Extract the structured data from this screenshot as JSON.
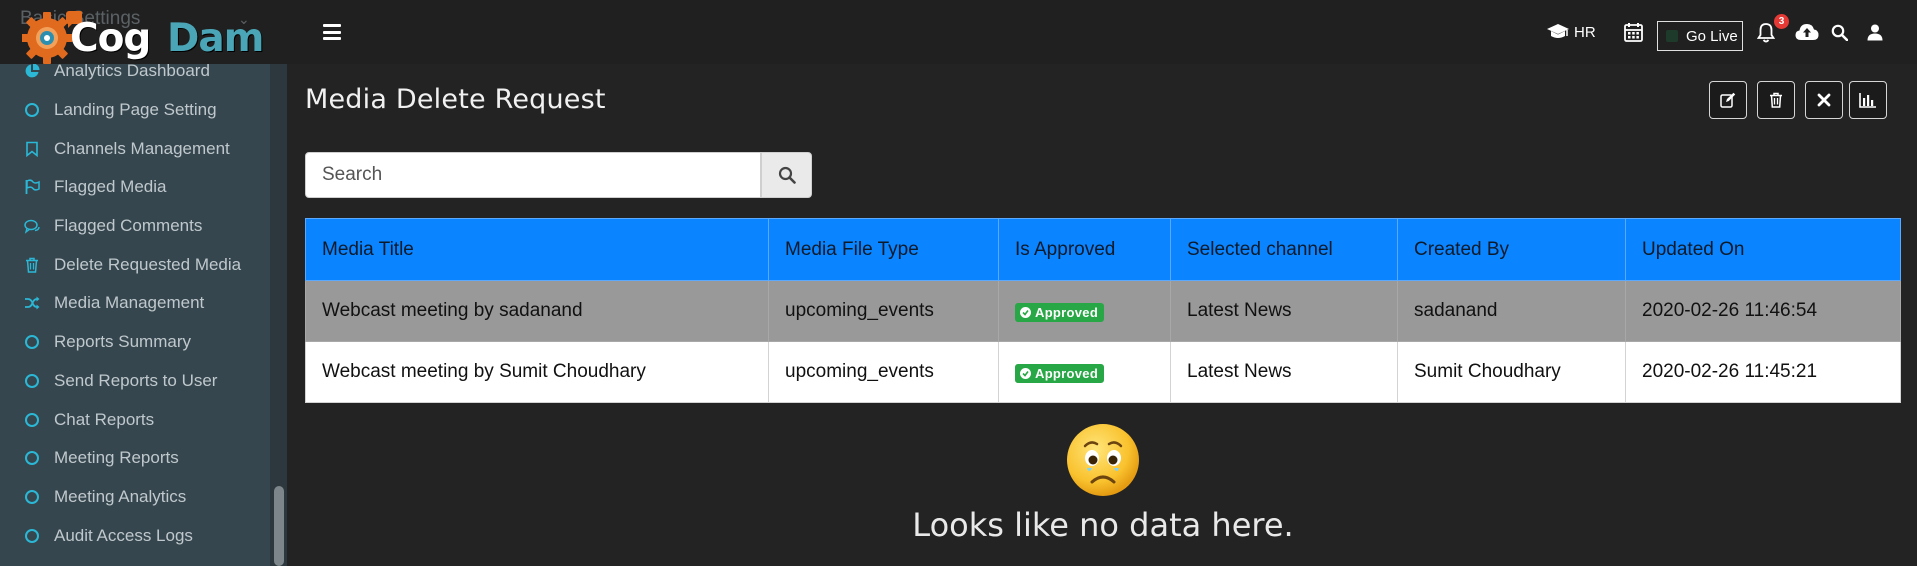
{
  "brand": {
    "logo_part1": "Cog",
    "logo_part2": "Dam",
    "hidden_menu_label": "Basic Settings"
  },
  "sidebar": {
    "items": [
      {
        "label": "Analytics Dashboard",
        "icon": "pie-chart-icon"
      },
      {
        "label": "Landing Page Setting",
        "icon": "circle-icon"
      },
      {
        "label": "Channels Management",
        "icon": "bookmark-icon"
      },
      {
        "label": "Flagged Media",
        "icon": "flag-icon"
      },
      {
        "label": "Flagged Comments",
        "icon": "comments-icon"
      },
      {
        "label": "Delete Requested Media",
        "icon": "trash-icon"
      },
      {
        "label": "Media Management",
        "icon": "shuffle-icon"
      },
      {
        "label": "Reports Summary",
        "icon": "circle-icon"
      },
      {
        "label": "Send Reports to User",
        "icon": "circle-icon"
      },
      {
        "label": "Chat Reports",
        "icon": "circle-icon"
      },
      {
        "label": "Meeting Reports",
        "icon": "circle-icon"
      },
      {
        "label": "Meeting Analytics",
        "icon": "circle-icon"
      },
      {
        "label": "Audit Access Logs",
        "icon": "circle-icon"
      }
    ]
  },
  "topbar": {
    "hr_label": "HR",
    "go_live_label": "Go Live",
    "notification_count": "3"
  },
  "page": {
    "title": "Media Delete Request",
    "search_placeholder": "Search",
    "empty_message": "Looks like no data here."
  },
  "table": {
    "columns": [
      "Media Title",
      "Media File Type",
      "Is Approved",
      "Selected channel",
      "Created By",
      "Updated On"
    ],
    "rows": [
      {
        "media_title": "Webcast meeting by sadanand",
        "media_file_type": "upcoming_events",
        "is_approved": "Approved",
        "selected_channel": "Latest News",
        "created_by": "sadanand",
        "updated_on": "2020-02-26 11:46:54"
      },
      {
        "media_title": "Webcast meeting by Sumit Choudhary",
        "media_file_type": "upcoming_events",
        "is_approved": "Approved",
        "selected_channel": "Latest News",
        "created_by": "Sumit Choudhary",
        "updated_on": "2020-02-26 11:45:21"
      }
    ]
  },
  "colors": {
    "header_blue": "#0a84ff",
    "approved_green": "#27a745",
    "sidebar_bg": "#36464e",
    "icon_cyan": "#2bb8d6"
  }
}
